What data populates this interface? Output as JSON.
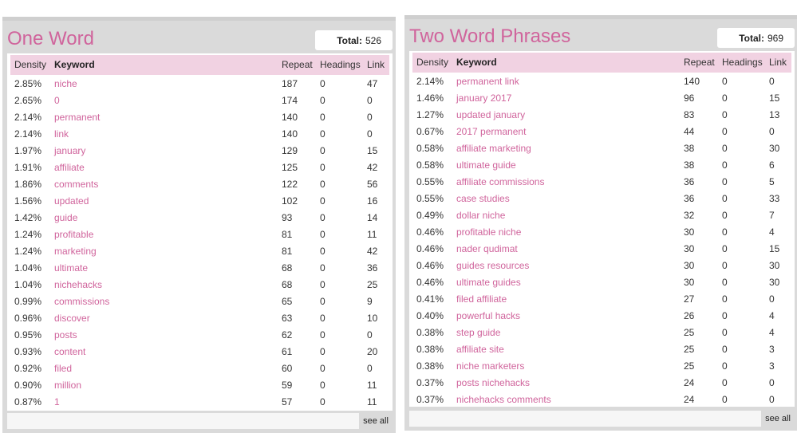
{
  "one_word": {
    "title": "One Word",
    "total_label": "Total:",
    "total_value": "526",
    "columns": {
      "density": "Density",
      "keyword": "Keyword",
      "repeat": "Repeat",
      "headings": "Headings",
      "link": "Link"
    },
    "rows": [
      {
        "density": "2.85%",
        "keyword": "niche",
        "repeat": "187",
        "headings": "0",
        "link": "47"
      },
      {
        "density": "2.65%",
        "keyword": "0",
        "repeat": "174",
        "headings": "0",
        "link": "0"
      },
      {
        "density": "2.14%",
        "keyword": "permanent",
        "repeat": "140",
        "headings": "0",
        "link": "0"
      },
      {
        "density": "2.14%",
        "keyword": "link",
        "repeat": "140",
        "headings": "0",
        "link": "0"
      },
      {
        "density": "1.97%",
        "keyword": "january",
        "repeat": "129",
        "headings": "0",
        "link": "15"
      },
      {
        "density": "1.91%",
        "keyword": "affiliate",
        "repeat": "125",
        "headings": "0",
        "link": "42"
      },
      {
        "density": "1.86%",
        "keyword": "comments",
        "repeat": "122",
        "headings": "0",
        "link": "56"
      },
      {
        "density": "1.56%",
        "keyword": "updated",
        "repeat": "102",
        "headings": "0",
        "link": "16"
      },
      {
        "density": "1.42%",
        "keyword": "guide",
        "repeat": "93",
        "headings": "0",
        "link": "14"
      },
      {
        "density": "1.24%",
        "keyword": "profitable",
        "repeat": "81",
        "headings": "0",
        "link": "11"
      },
      {
        "density": "1.24%",
        "keyword": "marketing",
        "repeat": "81",
        "headings": "0",
        "link": "42"
      },
      {
        "density": "1.04%",
        "keyword": "ultimate",
        "repeat": "68",
        "headings": "0",
        "link": "36"
      },
      {
        "density": "1.04%",
        "keyword": "nichehacks",
        "repeat": "68",
        "headings": "0",
        "link": "25"
      },
      {
        "density": "0.99%",
        "keyword": "commissions",
        "repeat": "65",
        "headings": "0",
        "link": "9"
      },
      {
        "density": "0.96%",
        "keyword": "discover",
        "repeat": "63",
        "headings": "0",
        "link": "10"
      },
      {
        "density": "0.95%",
        "keyword": "posts",
        "repeat": "62",
        "headings": "0",
        "link": "0"
      },
      {
        "density": "0.93%",
        "keyword": "content",
        "repeat": "61",
        "headings": "0",
        "link": "20"
      },
      {
        "density": "0.92%",
        "keyword": "filed",
        "repeat": "60",
        "headings": "0",
        "link": "0"
      },
      {
        "density": "0.90%",
        "keyword": "million",
        "repeat": "59",
        "headings": "0",
        "link": "11"
      },
      {
        "density": "0.87%",
        "keyword": "1",
        "repeat": "57",
        "headings": "0",
        "link": "11"
      }
    ],
    "see_all": "see all"
  },
  "two_word": {
    "title": "Two Word Phrases",
    "total_label": "Total:",
    "total_value": "969",
    "columns": {
      "density": "Density",
      "keyword": "Keyword",
      "repeat": "Repeat",
      "headings": "Headings",
      "link": "Link"
    },
    "rows": [
      {
        "density": "2.14%",
        "keyword": "permanent link",
        "repeat": "140",
        "headings": "0",
        "link": "0"
      },
      {
        "density": "1.46%",
        "keyword": "january 2017",
        "repeat": "96",
        "headings": "0",
        "link": "15"
      },
      {
        "density": "1.27%",
        "keyword": "updated january",
        "repeat": "83",
        "headings": "0",
        "link": "13"
      },
      {
        "density": "0.67%",
        "keyword": "2017 permanent",
        "repeat": "44",
        "headings": "0",
        "link": "0"
      },
      {
        "density": "0.58%",
        "keyword": "affiliate marketing",
        "repeat": "38",
        "headings": "0",
        "link": "30"
      },
      {
        "density": "0.58%",
        "keyword": "ultimate guide",
        "repeat": "38",
        "headings": "0",
        "link": "6"
      },
      {
        "density": "0.55%",
        "keyword": "affiliate commissions",
        "repeat": "36",
        "headings": "0",
        "link": "5"
      },
      {
        "density": "0.55%",
        "keyword": "case studies",
        "repeat": "36",
        "headings": "0",
        "link": "33"
      },
      {
        "density": "0.49%",
        "keyword": "dollar niche",
        "repeat": "32",
        "headings": "0",
        "link": "7"
      },
      {
        "density": "0.46%",
        "keyword": "profitable niche",
        "repeat": "30",
        "headings": "0",
        "link": "4"
      },
      {
        "density": "0.46%",
        "keyword": "nader qudimat",
        "repeat": "30",
        "headings": "0",
        "link": "15"
      },
      {
        "density": "0.46%",
        "keyword": "guides resources",
        "repeat": "30",
        "headings": "0",
        "link": "30"
      },
      {
        "density": "0.46%",
        "keyword": "ultimate guides",
        "repeat": "30",
        "headings": "0",
        "link": "30"
      },
      {
        "density": "0.41%",
        "keyword": "filed affiliate",
        "repeat": "27",
        "headings": "0",
        "link": "0"
      },
      {
        "density": "0.40%",
        "keyword": "powerful hacks",
        "repeat": "26",
        "headings": "0",
        "link": "4"
      },
      {
        "density": "0.38%",
        "keyword": "step guide",
        "repeat": "25",
        "headings": "0",
        "link": "4"
      },
      {
        "density": "0.38%",
        "keyword": "affiliate site",
        "repeat": "25",
        "headings": "0",
        "link": "3"
      },
      {
        "density": "0.38%",
        "keyword": "niche marketers",
        "repeat": "25",
        "headings": "0",
        "link": "3"
      },
      {
        "density": "0.37%",
        "keyword": "posts nichehacks",
        "repeat": "24",
        "headings": "0",
        "link": "0"
      },
      {
        "density": "0.37%",
        "keyword": "nichehacks comments",
        "repeat": "24",
        "headings": "0",
        "link": "0"
      }
    ],
    "see_all": "see all"
  },
  "colors": {
    "accent": "#d0649c",
    "header_bg": "#f1d2e2",
    "panel_bg": "#dadada"
  }
}
